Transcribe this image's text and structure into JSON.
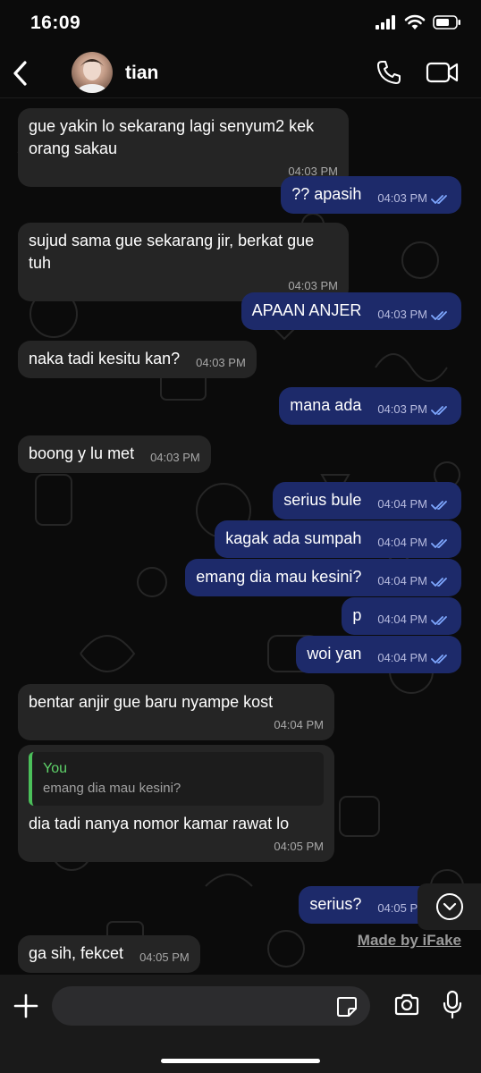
{
  "status_bar": {
    "time": "16:09"
  },
  "header": {
    "contact_name": "tian"
  },
  "messages": [
    {
      "dir": "in",
      "text": "gue yakin lo sekarang lagi senyum2 kek orang sakau",
      "time": "04:03 PM"
    },
    {
      "dir": "out",
      "text": "?? apasih",
      "time": "04:03 PM"
    },
    {
      "dir": "in",
      "text": "sujud sama gue sekarang jir, berkat gue tuh",
      "time": "04:03 PM"
    },
    {
      "dir": "out",
      "text": "APAAN ANJER",
      "time": "04:03 PM"
    },
    {
      "dir": "in",
      "text": "naka tadi kesitu kan?",
      "time": "04:03 PM"
    },
    {
      "dir": "out",
      "text": "mana ada",
      "time": "04:03 PM"
    },
    {
      "dir": "in",
      "text": "boong y lu met",
      "time": "04:03 PM"
    },
    {
      "dir": "out",
      "text": "serius bule",
      "time": "04:04 PM"
    },
    {
      "dir": "out",
      "text": "kagak ada sumpah",
      "time": "04:04 PM"
    },
    {
      "dir": "out",
      "text": "emang dia mau kesini?",
      "time": "04:04 PM"
    },
    {
      "dir": "out",
      "text": "p",
      "time": "04:04 PM"
    },
    {
      "dir": "out",
      "text": "woi yan",
      "time": "04:04 PM"
    },
    {
      "dir": "in",
      "text": "bentar anjir gue baru nyampe kost",
      "time": "04:04 PM"
    },
    {
      "dir": "in",
      "text": "dia tadi nanya nomor kamar rawat lo",
      "time": "04:05 PM",
      "reply_author": "You",
      "reply_text": "emang dia mau kesini?"
    },
    {
      "dir": "out",
      "text": "serius?",
      "time": "04:05 PM"
    },
    {
      "dir": "in",
      "text": "ga sih, fekcet",
      "time": "04:05 PM"
    }
  ],
  "watermark": "Made by iFake",
  "colors": {
    "incoming_bubble": "#252525",
    "outgoing_bubble": "#1d2a6a",
    "reply_accent": "#4bc05a",
    "read_tick": "#7fa8ff"
  }
}
